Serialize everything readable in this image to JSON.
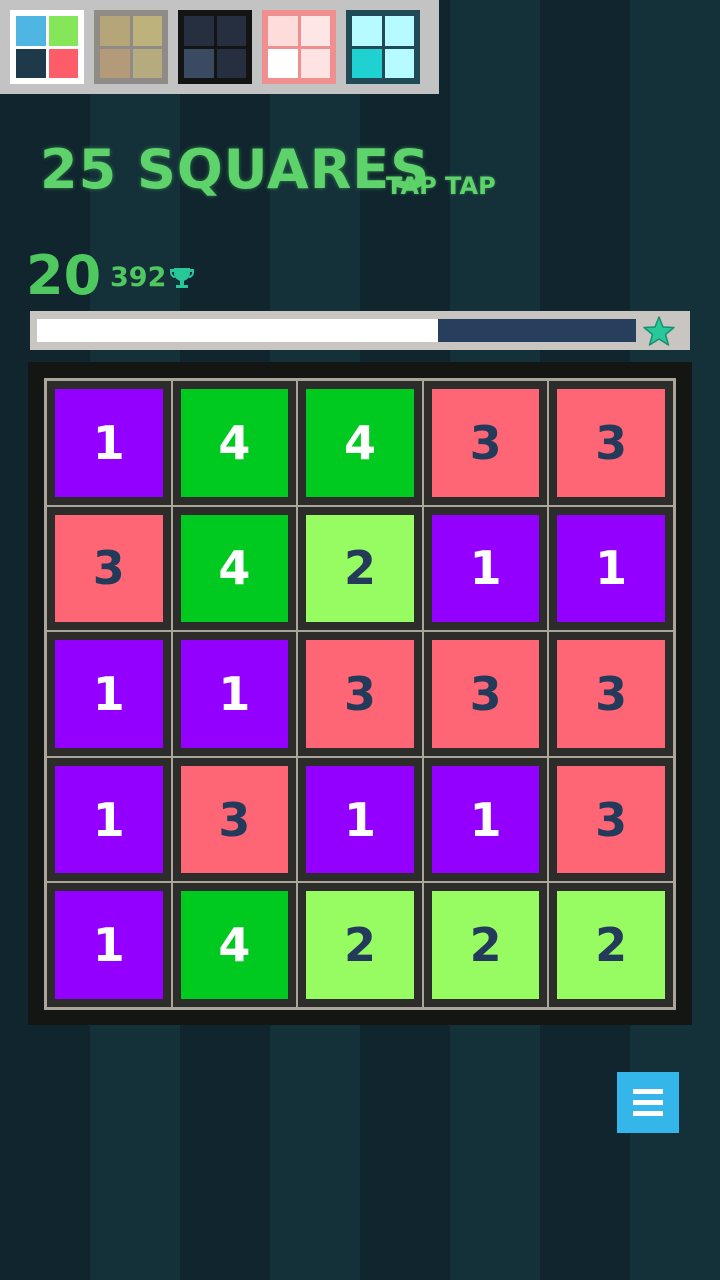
{
  "app": {
    "title": "25 SQUARES",
    "subtitle": "TAP TAP"
  },
  "themes": [
    {
      "name": "classic",
      "selected": true,
      "frame": "#ffffff",
      "tiles": [
        "#4fb6e3",
        "#86e65a",
        "#1e3a4a",
        "#ff5c6a"
      ]
    },
    {
      "name": "khaki",
      "selected": false,
      "frame": "#8f8c87",
      "tiles": [
        "#b5a578",
        "#bdb17c",
        "#b39a78",
        "#b5ab7e"
      ]
    },
    {
      "name": "dark",
      "selected": false,
      "frame": "#141414",
      "tiles": [
        "#252f3f",
        "#252f3f",
        "#3a4a60",
        "#252f3f"
      ]
    },
    {
      "name": "pink",
      "selected": false,
      "frame": "#f08f8f",
      "tiles": [
        "#ffdcdc",
        "#ffe6e6",
        "#ffffff",
        "#ffe2e2"
      ]
    },
    {
      "name": "aqua",
      "selected": false,
      "frame": "#1f4a56",
      "tiles": [
        "#b6fbff",
        "#b6fbff",
        "#1fd1d1",
        "#b6fbff"
      ]
    }
  ],
  "stats": {
    "score": "20",
    "best": "392"
  },
  "progress": {
    "fraction": 0.67,
    "fill_color": "#ffffff",
    "track_color": "#283e5d",
    "star_color": "#27c99a"
  },
  "palette": {
    "1": {
      "bg": "#9400ff",
      "fg": "#ffffff"
    },
    "2": {
      "bg": "#97fc61",
      "fg": "#243a5b"
    },
    "3": {
      "bg": "#ff6675",
      "fg": "#243a5b"
    },
    "4": {
      "bg": "#00c91f",
      "fg": "#ffffff"
    }
  },
  "board": [
    [
      "1",
      "4",
      "4",
      "3",
      "3"
    ],
    [
      "3",
      "4",
      "2",
      "1",
      "1"
    ],
    [
      "1",
      "1",
      "3",
      "3",
      "3"
    ],
    [
      "1",
      "3",
      "1",
      "1",
      "3"
    ],
    [
      "1",
      "4",
      "2",
      "2",
      "2"
    ]
  ],
  "menu": {
    "icon": "hamburger-icon",
    "color": "#35b6ea"
  }
}
